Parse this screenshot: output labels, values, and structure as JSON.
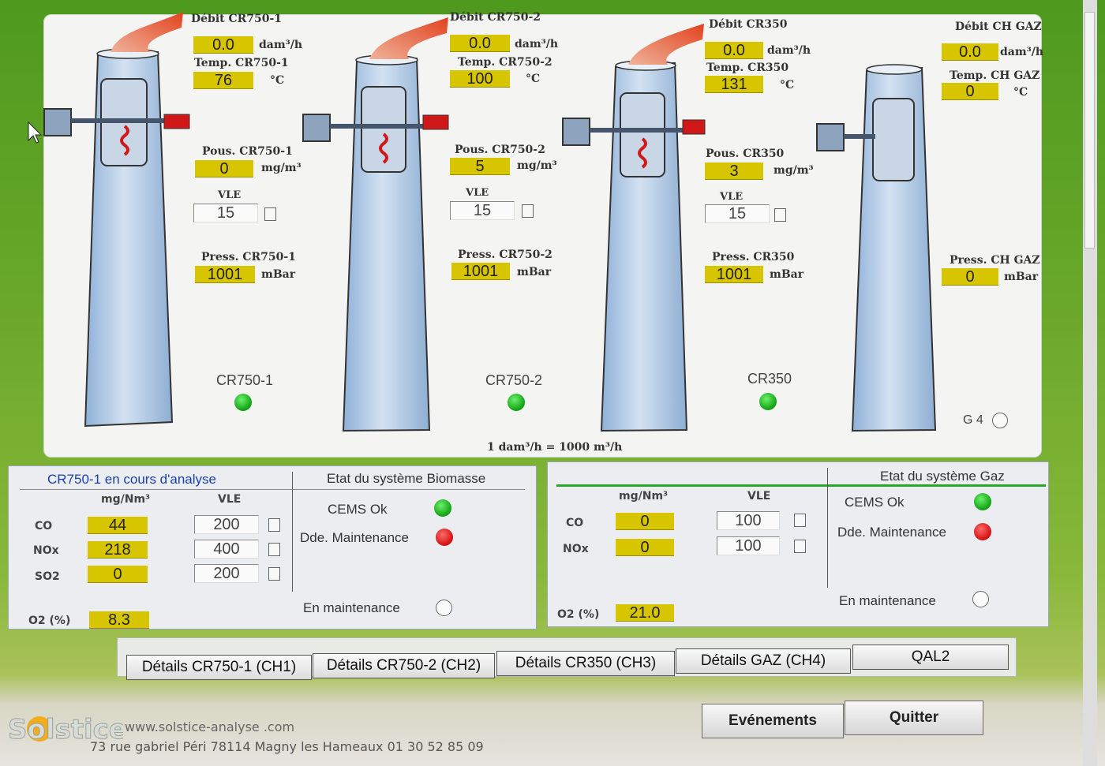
{
  "stacks": [
    {
      "name": "CR750-1",
      "debit_label": "Débit CR750-1",
      "debit_value": "0.0",
      "debit_unit": "dam³/h",
      "temp_label": "Temp. CR750-1",
      "temp_value": "76",
      "temp_unit": "°C",
      "pous_label": "Pous. CR750-1",
      "pous_value": "0",
      "pous_unit": "mg/m³",
      "vle_label": "VLE",
      "vle_value": "15",
      "press_label": "Press. CR750-1",
      "press_value": "1001",
      "press_unit": "mBar",
      "status_label": "CR750-1"
    },
    {
      "name": "CR750-2",
      "debit_label": "Débit CR750-2",
      "debit_value": "0.0",
      "debit_unit": "dam³/h",
      "temp_label": "Temp. CR750-2",
      "temp_value": "100",
      "temp_unit": "°C",
      "pous_label": "Pous. CR750-2",
      "pous_value": "5",
      "pous_unit": "mg/m³",
      "vle_label": "VLE",
      "vle_value": "15",
      "press_label": "Press. CR750-2",
      "press_value": "1001",
      "press_unit": "mBar",
      "status_label": "CR750-2"
    },
    {
      "name": "CR350",
      "debit_label": "Débit CR350",
      "debit_value": "0.0",
      "debit_unit": "dam³/h",
      "temp_label": "Temp. CR350",
      "temp_value": "131",
      "temp_unit": "°C",
      "pous_label": "Pous. CR350",
      "pous_value": "3",
      "pous_unit": "mg/m³",
      "vle_label": "VLE",
      "vle_value": "15",
      "press_label": "Press. CR350",
      "press_value": "1001",
      "press_unit": "mBar",
      "status_label": "CR350"
    },
    {
      "name": "CH GAZ",
      "debit_label": "Débit CH GAZ",
      "debit_value": "0.0",
      "debit_unit": "dam³/h",
      "temp_label": "Temp. CH GAZ",
      "temp_value": "0",
      "temp_unit": "°C",
      "press_label": "Press. CH GAZ",
      "press_value": "0",
      "press_unit": "mBar",
      "status_label": "G 4"
    }
  ],
  "conversion_note": "1 dam³/h = 1000 m³/h",
  "biomasse": {
    "title": "CR750-1 en cours d'analyse",
    "etat_title": "Etat du système Biomasse",
    "col_unit": "mg/Nm³",
    "col_vle": "VLE",
    "rows": [
      {
        "label": "CO",
        "value": "44",
        "vle": "200"
      },
      {
        "label": "NOx",
        "value": "218",
        "vle": "400"
      },
      {
        "label": "SO2",
        "value": "0",
        "vle": "200"
      }
    ],
    "o2_label": "O2 (%)",
    "o2_value": "8.3",
    "cems": "CEMS Ok",
    "maintenance_req": "Dde. Maintenance",
    "en_maintenance": "En maintenance"
  },
  "gaz": {
    "etat_title": "Etat du système Gaz",
    "col_unit": "mg/Nm³",
    "col_vle": "VLE",
    "rows": [
      {
        "label": "CO",
        "value": "0",
        "vle": "100"
      },
      {
        "label": "NOx",
        "value": "0",
        "vle": "100"
      }
    ],
    "o2_label": "O2 (%)",
    "o2_value": "21.0",
    "cems": "CEMS Ok",
    "maintenance_req": "Dde. Maintenance",
    "en_maintenance": "En maintenance"
  },
  "tabs": [
    "Détails CR750-1 (CH1)",
    "Détails CR750-2 (CH2)",
    "Détails CR350 (CH3)",
    "Détails GAZ (CH4)",
    "QAL2"
  ],
  "actions": {
    "events": "Evénements",
    "quit": "Quitter"
  },
  "footer": {
    "logo": "Solstice",
    "url": "www.solstice-analyse .com",
    "address": "73 rue gabriel Péri 78114 Magny les Hameaux 01 30 52 85 09"
  },
  "colors": {
    "value_bg": "#d7c500",
    "ok": "#19b319",
    "alarm": "#d40f0f",
    "panel_title": "#1a3fb0"
  }
}
